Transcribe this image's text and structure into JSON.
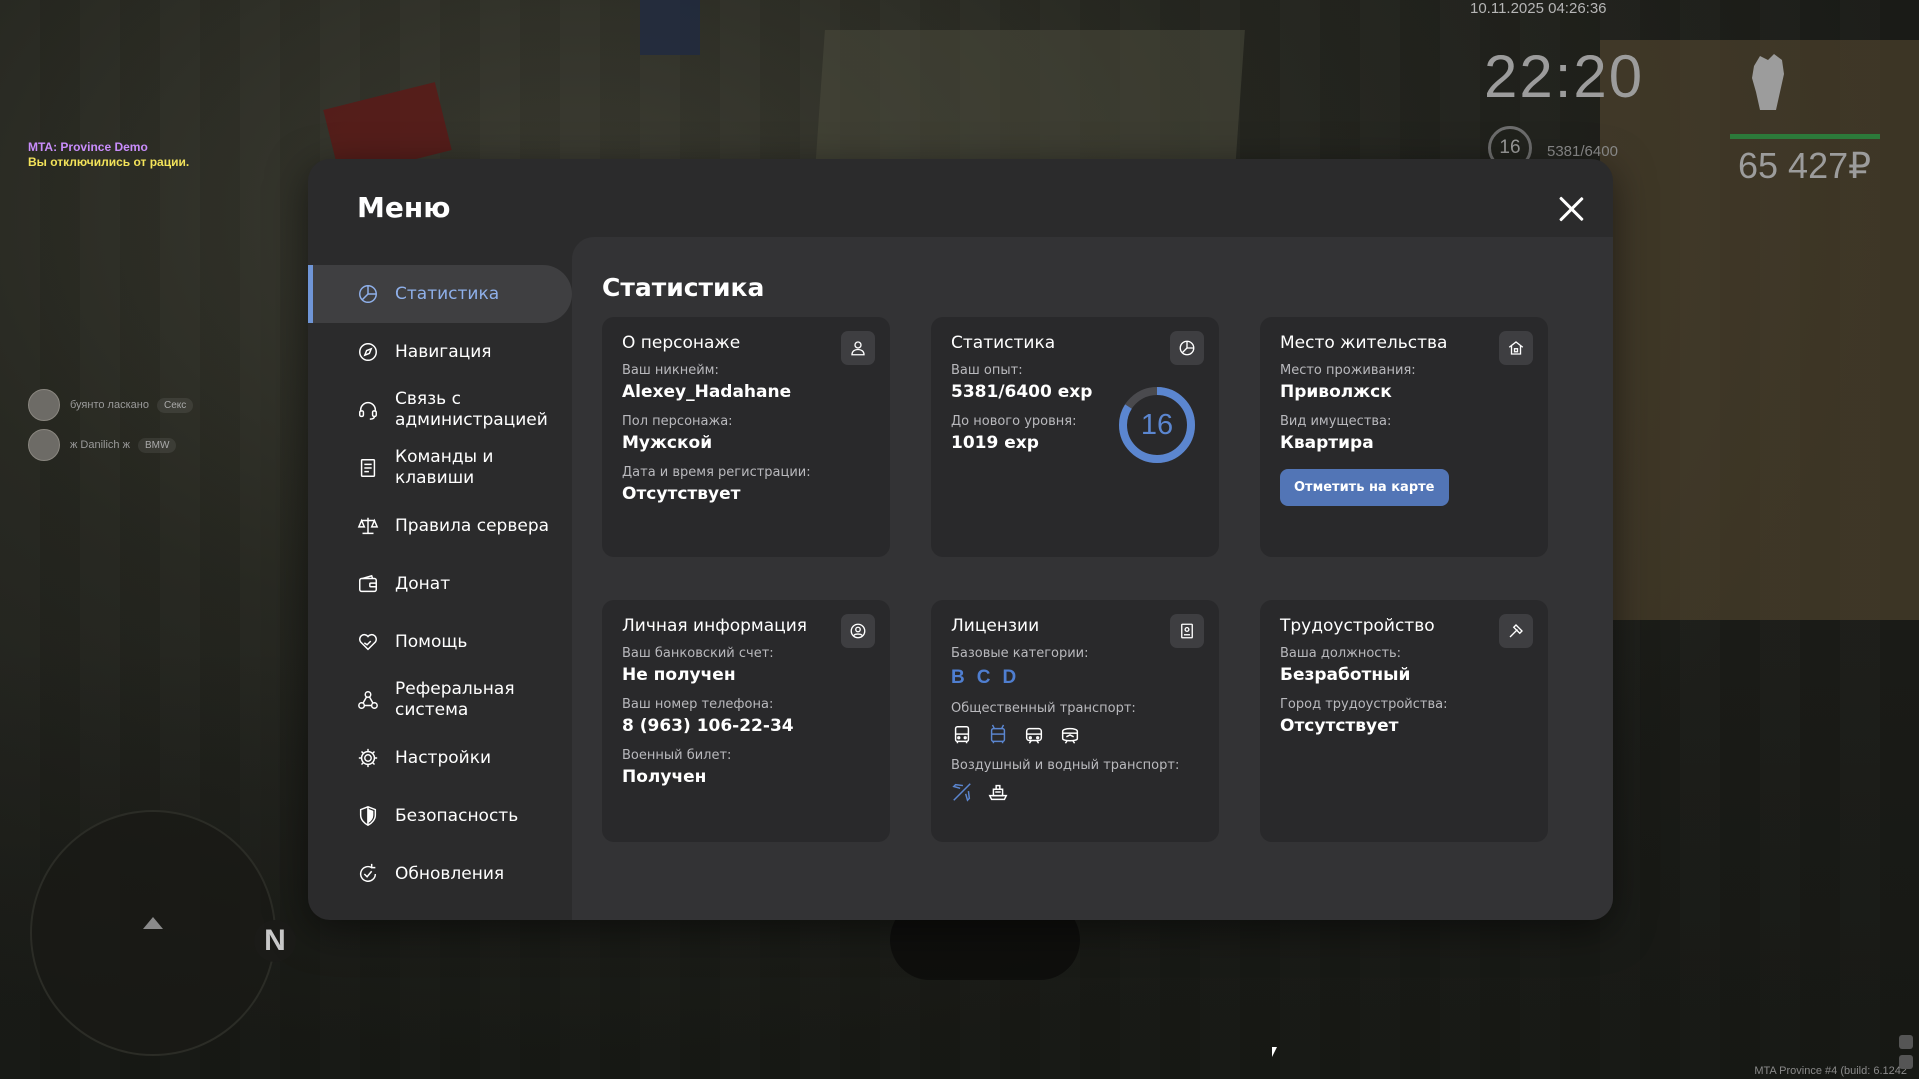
{
  "hud": {
    "datetime": "10.11.2025 04:26:36",
    "time": "22:20",
    "level": "16",
    "exp": "5381/6400",
    "money": "65 427₽",
    "build": "MTA Province #4 (build: 6.1242"
  },
  "chat": {
    "line1": "MTA: Province Demo",
    "line2": "Вы отключились от рации."
  },
  "voice": [
    {
      "name": "буянто ласкано",
      "tag": "Секс"
    },
    {
      "name": "ж Danilich ж",
      "tag": "BMW"
    }
  ],
  "radar": {
    "north": "N"
  },
  "menu": {
    "title": "Меню",
    "nav": [
      {
        "label": "Статистика",
        "icon": "pie-chart-icon"
      },
      {
        "label": "Навигация",
        "icon": "compass-icon"
      },
      {
        "label": "Связь с администрацией",
        "icon": "headset-icon"
      },
      {
        "label": "Команды и клавиши",
        "icon": "document-icon"
      },
      {
        "label": "Правила сервера",
        "icon": "scales-icon"
      },
      {
        "label": "Донат",
        "icon": "wallet-icon"
      },
      {
        "label": "Помощь",
        "icon": "heart-hand-icon"
      },
      {
        "label": "Реферальная система",
        "icon": "referral-icon"
      },
      {
        "label": "Настройки",
        "icon": "gear-icon"
      },
      {
        "label": "Безопасность",
        "icon": "shield-icon"
      },
      {
        "label": "Обновления",
        "icon": "refresh-icon"
      }
    ],
    "active_index": 0
  },
  "stats": {
    "title": "Статистика",
    "character": {
      "title": "О персонаже",
      "nick_label": "Ваш никнейм:",
      "nick": "Alexey_Hadahane",
      "gender_label": "Пол персонажа:",
      "gender": "Мужской",
      "reg_label": "Дата и время регистрации:",
      "reg": "Отсутствует"
    },
    "statistics": {
      "title": "Статистика",
      "exp_label": "Ваш опыт:",
      "exp": "5381/6400 exp",
      "next_label": "До нового уровня:",
      "next": "1019 exp",
      "level": "16",
      "progress": 0.84
    },
    "residence": {
      "title": "Место жительства",
      "place_label": "Место проживания:",
      "place": "Приволжск",
      "type_label": "Вид имущества:",
      "type": "Квартира",
      "button": "Отметить на карте"
    },
    "personal": {
      "title": "Личная информация",
      "bank_label": "Ваш банковский счет:",
      "bank": "Не получен",
      "phone_label": "Ваш номер телефона:",
      "phone": "8 (963) 106-22-34",
      "military_label": "Военный билет:",
      "military": "Получен"
    },
    "licenses": {
      "title": "Лицензии",
      "base_label": "Базовые категории:",
      "categories": [
        "B",
        "C",
        "D"
      ],
      "public_label": "Общественный транспорт:",
      "public_icons": [
        "bus-icon",
        "trolleybus-icon",
        "tram-icon",
        "metro-icon"
      ],
      "air_label": "Воздушный и водный транспорт:",
      "air_icons": [
        "plane-icon",
        "boat-icon"
      ]
    },
    "employment": {
      "title": "Трудоустройство",
      "position_label": "Ваша должность:",
      "position": "Безработный",
      "city_label": "Город трудоустройства:",
      "city": "Отсутствует"
    }
  },
  "colors": {
    "accent": "#5b86d0",
    "button": "#5275b6",
    "panel": "#2b2b2c",
    "content": "#333335",
    "card": "#29292b"
  }
}
